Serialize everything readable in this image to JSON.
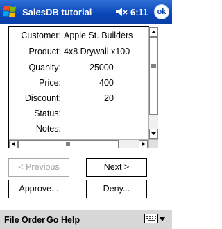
{
  "titlebar": {
    "title": "SalesDB tutorial",
    "time": "6:11",
    "ok_label": "ok"
  },
  "record": {
    "fields": [
      {
        "label": "Customer:",
        "value": "Apple St. Builders"
      },
      {
        "label": "Product:",
        "value": "4x8 Drywall x100"
      },
      {
        "label": "Quanity:",
        "value": "25000"
      },
      {
        "label": "Price:",
        "value": "400"
      },
      {
        "label": "Discount:",
        "value": "20"
      },
      {
        "label": "Status:",
        "value": ""
      },
      {
        "label": "Notes:",
        "value": ""
      }
    ]
  },
  "buttons": {
    "previous": "< Previous",
    "next": "Next >",
    "approve": "Approve...",
    "deny": "Deny..."
  },
  "menu": {
    "file": "File",
    "order": "Order",
    "go": "Go",
    "help": "Help"
  },
  "colors": {
    "titlebar": "#0a46b8",
    "menubar": "#d7d7d7",
    "disabled_text": "#a0a0a0"
  },
  "icons": {
    "start": "windows-flag-icon",
    "volume": "speaker-icon",
    "keyboard": "keyboard-icon"
  }
}
